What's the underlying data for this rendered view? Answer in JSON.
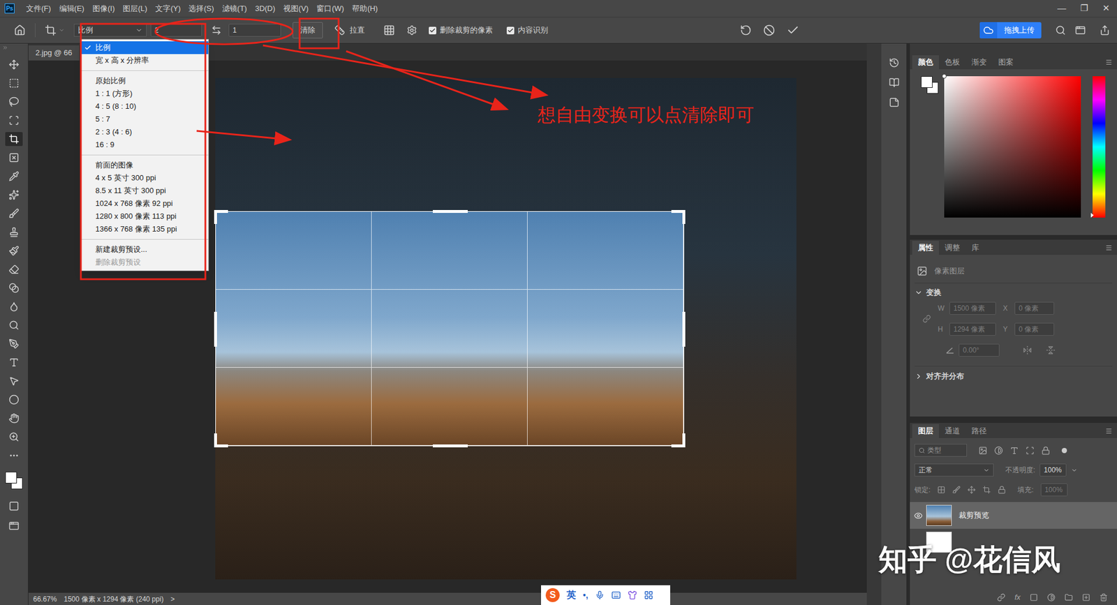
{
  "app": {
    "logo": "Ps"
  },
  "menu": [
    "文件(F)",
    "编辑(E)",
    "图像(I)",
    "图层(L)",
    "文字(Y)",
    "选择(S)",
    "滤镜(T)",
    "3D(D)",
    "视图(V)",
    "窗口(W)",
    "帮助(H)"
  ],
  "window_controls": [
    "—",
    "❐",
    "✕"
  ],
  "options_bar": {
    "ratio_select": "比例",
    "width_value": "2",
    "height_value": "1",
    "clear_button": "清除",
    "straighten": "拉直",
    "checkboxes": [
      {
        "label": "删除裁剪的像素",
        "checked": true
      },
      {
        "label": "内容识别",
        "checked": true
      }
    ],
    "upload_button": "拖拽上传"
  },
  "document_tab": {
    "title": "2.jpg @ 66"
  },
  "tools": [
    {
      "selected": false
    },
    {
      "selected": false
    },
    {
      "selected": false
    },
    {
      "selected": false
    },
    {
      "selected": true
    },
    {
      "selected": false
    },
    {
      "selected": false
    },
    {
      "selected": false
    },
    {
      "selected": false
    },
    {
      "selected": false
    },
    {
      "selected": false
    },
    {
      "selected": false
    },
    {
      "selected": false
    },
    {
      "selected": false
    },
    {
      "selected": false
    },
    {
      "selected": false
    },
    {
      "selected": false
    },
    {
      "selected": false
    },
    {
      "selected": false
    },
    {
      "selected": false
    },
    {
      "selected": false
    },
    {
      "selected": false
    }
  ],
  "ratio_menu": {
    "sections": [
      [
        {
          "label": "比例",
          "selected": true,
          "disabled": false
        },
        {
          "label": "宽 x 高 x 分辨率",
          "selected": false,
          "disabled": false
        }
      ],
      [
        {
          "label": "原始比例",
          "selected": false,
          "disabled": false
        },
        {
          "label": "1 : 1 (方形)",
          "selected": false,
          "disabled": false
        },
        {
          "label": "4 : 5 (8 : 10)",
          "selected": false,
          "disabled": false
        },
        {
          "label": "5 : 7",
          "selected": false,
          "disabled": false
        },
        {
          "label": "2 : 3 (4 : 6)",
          "selected": false,
          "disabled": false
        },
        {
          "label": "16 : 9",
          "selected": false,
          "disabled": false
        }
      ],
      [
        {
          "label": "前面的图像",
          "selected": false,
          "disabled": false
        },
        {
          "label": "4 x 5 英寸 300 ppi",
          "selected": false,
          "disabled": false
        },
        {
          "label": "8.5 x 11 英寸 300 ppi",
          "selected": false,
          "disabled": false
        },
        {
          "label": "1024 x 768 像素 92 ppi",
          "selected": false,
          "disabled": false
        },
        {
          "label": "1280 x 800 像素 113 ppi",
          "selected": false,
          "disabled": false
        },
        {
          "label": "1366 x 768 像素 135 ppi",
          "selected": false,
          "disabled": false
        }
      ],
      [
        {
          "label": "新建裁剪预设...",
          "selected": false,
          "disabled": false
        },
        {
          "label": "删除裁剪预设",
          "selected": false,
          "disabled": true
        }
      ]
    ]
  },
  "color_panel": {
    "tabs": [
      {
        "label": "颜色",
        "selected": true
      },
      {
        "label": "色板",
        "selected": false
      },
      {
        "label": "渐变",
        "selected": false
      },
      {
        "label": "图案",
        "selected": false
      }
    ]
  },
  "properties_panel": {
    "tabs": [
      {
        "label": "属性",
        "selected": true
      },
      {
        "label": "调整",
        "selected": false
      },
      {
        "label": "库",
        "selected": false
      }
    ],
    "layer_kind": "像素图层",
    "transform": {
      "title": "变换",
      "expanded": true,
      "w_label": "W",
      "w": "1500 像素",
      "x_label": "X",
      "x": "0 像素",
      "h_label": "H",
      "h": "1294 像素",
      "y_label": "Y",
      "y": "0 像素",
      "angle": "0.00°"
    },
    "align": {
      "title": "对齐并分布",
      "expanded": false
    }
  },
  "layers_panel": {
    "tabs": [
      {
        "label": "图层",
        "selected": true
      },
      {
        "label": "通道",
        "selected": false
      },
      {
        "label": "路径",
        "selected": false
      }
    ],
    "filter": "类型",
    "blend_mode": "正常",
    "opacity_label": "不透明度:",
    "opacity": "100%",
    "lock_label": "锁定:",
    "fill_label": "填充:",
    "fill": "100%",
    "fill_disabled": true,
    "layers": [
      {
        "name": "裁剪预览",
        "selected": true,
        "visible": true
      }
    ],
    "background_layer": {
      "selected": false,
      "visible": false
    },
    "footer_fx": "fx"
  },
  "status_bar": {
    "zoom": "66.67%",
    "info": "1500 像素 x 1294 像素 (240 ppi)",
    "arrow": ">"
  },
  "annotation": {
    "text": "想自由变换可以点清除即可"
  },
  "watermark": "知乎 @花信风",
  "ime_bar": {
    "logo": "S",
    "mode": "英",
    "punct": "•,"
  }
}
